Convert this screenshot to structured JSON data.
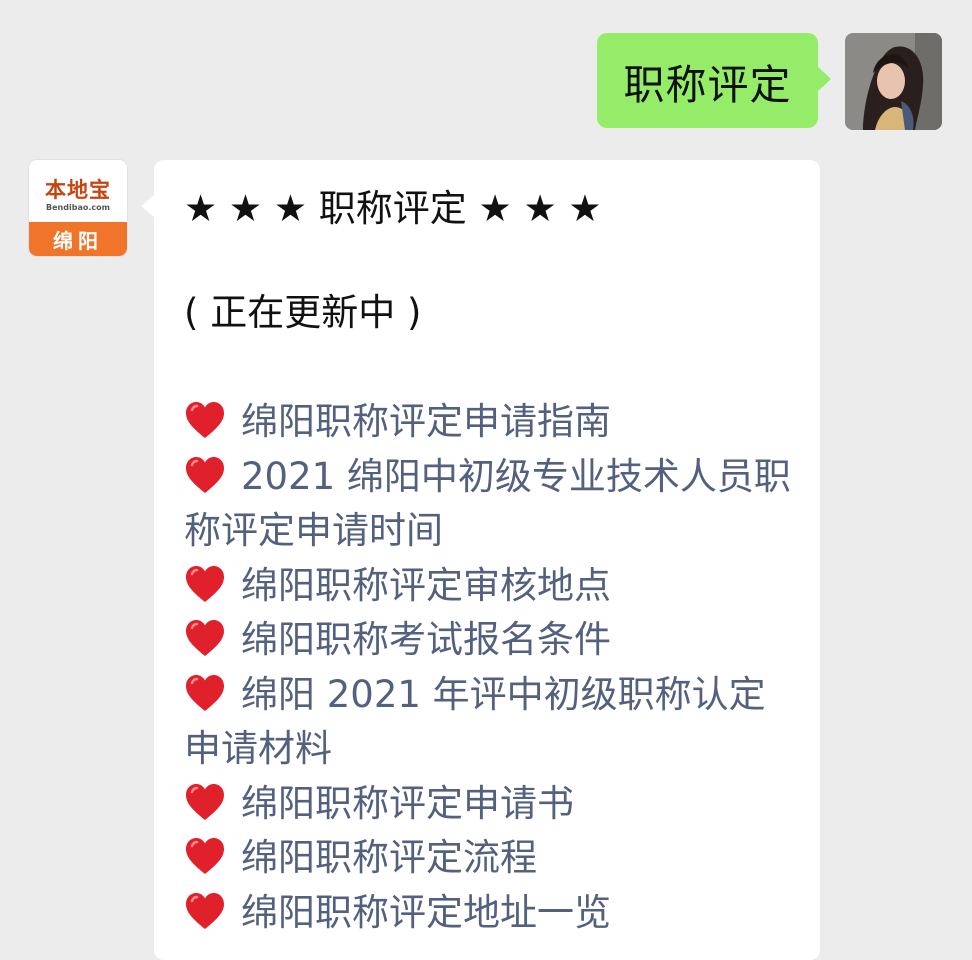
{
  "outgoing": {
    "text": "职称评定",
    "bubble_color": "#95ec69"
  },
  "incoming": {
    "avatar": {
      "brand": "本地宝",
      "brand_sub": "Bendibao.com",
      "city": "绵阳",
      "accent_color": "#f0742a"
    },
    "title": "★ ★ ★ 职称评定 ★ ★ ★",
    "status": "( 正在更新中 )",
    "bullet_icon": "heart-icon",
    "link_color": "#54617e",
    "links": [
      {
        "label": "绵阳职称评定申请指南"
      },
      {
        "label": "2021 绵阳中初级专业技术人员职称评定申请时间"
      },
      {
        "label": "绵阳职称评定审核地点"
      },
      {
        "label": "绵阳职称考试报名条件"
      },
      {
        "label": "绵阳 2021 年评中初级职称认定申请材料"
      },
      {
        "label": "绵阳职称评定申请书"
      },
      {
        "label": "绵阳职称评定流程"
      },
      {
        "label": "绵阳职称评定地址一览"
      }
    ]
  }
}
